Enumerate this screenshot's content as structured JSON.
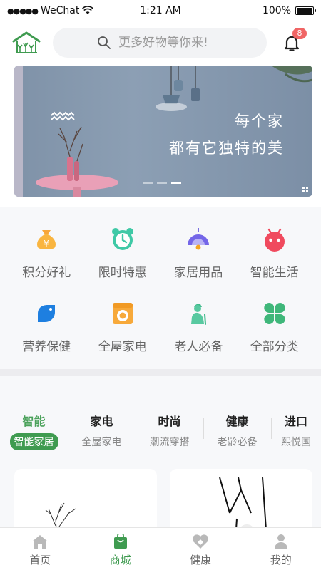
{
  "status_bar": {
    "carrier": "WeChat",
    "time": "1:21 AM",
    "battery": "100%",
    "battery_level": 1.0
  },
  "header": {
    "search_placeholder": "更多好物等你来!",
    "notification_count": "8"
  },
  "banner": {
    "line1": "每个家",
    "line2": "都有它独特的美",
    "slide_count": 3,
    "active_slide": 3
  },
  "categories": [
    {
      "label": "积分好礼",
      "icon": "money-bag-icon"
    },
    {
      "label": "限时特惠",
      "icon": "alarm-clock-icon"
    },
    {
      "label": "家居用品",
      "icon": "lamp-icon"
    },
    {
      "label": "智能生活",
      "icon": "robot-icon"
    },
    {
      "label": "营养保健",
      "icon": "leaf-icon"
    },
    {
      "label": "全屋家电",
      "icon": "washing-machine-icon"
    },
    {
      "label": "老人必备",
      "icon": "elder-icon"
    },
    {
      "label": "全部分类",
      "icon": "grid-clover-icon"
    }
  ],
  "tabs": [
    {
      "title": "智能",
      "sub": "智能家居",
      "active": true
    },
    {
      "title": "家电",
      "sub": "全屋家电"
    },
    {
      "title": "时尚",
      "sub": "潮流穿搭"
    },
    {
      "title": "健康",
      "sub": "老龄必备"
    },
    {
      "title": "进口",
      "sub": "熙悦国"
    }
  ],
  "bottom_nav": [
    {
      "label": "首页",
      "icon": "home-icon"
    },
    {
      "label": "商城",
      "icon": "shopping-bag-icon",
      "active": true
    },
    {
      "label": "健康",
      "icon": "heart-icon"
    },
    {
      "label": "我的",
      "icon": "user-icon"
    }
  ],
  "colors": {
    "accent": "#3f9b50",
    "badge": "#f06565"
  }
}
